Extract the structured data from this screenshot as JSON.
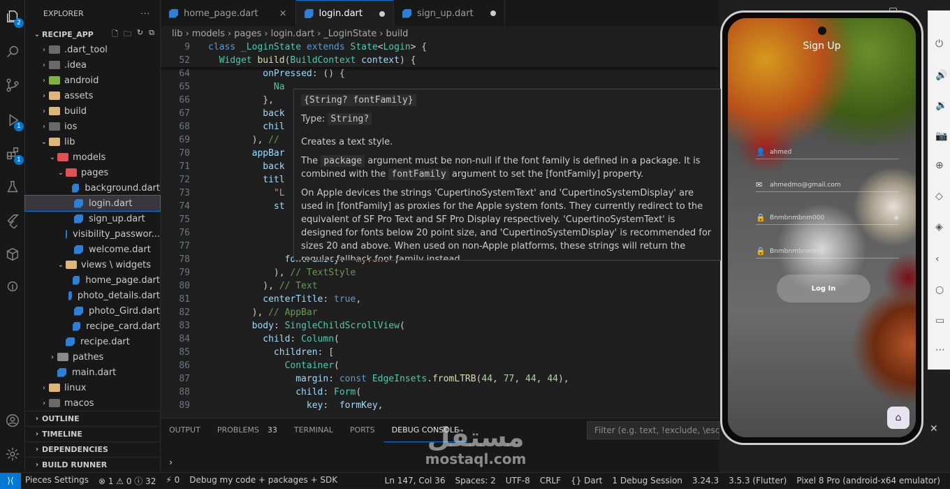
{
  "activity": {
    "explorer_badge": "2",
    "run_badge": "1",
    "extensions_badge": "1"
  },
  "sidebar": {
    "title": "EXPLORER",
    "more": "···",
    "project": "RECIPE_APP",
    "tree": [
      {
        "label": ".dart_tool",
        "type": "folder",
        "depth": 1,
        "chev": "›",
        "color": "#6a6a6a"
      },
      {
        "label": ".idea",
        "type": "folder",
        "depth": 1,
        "chev": "›",
        "color": "#6a6a6a"
      },
      {
        "label": "android",
        "type": "folder",
        "depth": 1,
        "chev": "›",
        "color": "#7cb342"
      },
      {
        "label": "assets",
        "type": "folder",
        "depth": 1,
        "chev": "›",
        "color": "#dcb67a"
      },
      {
        "label": "build",
        "type": "folder",
        "depth": 1,
        "chev": "›",
        "color": "#dcb67a"
      },
      {
        "label": "ios",
        "type": "folder",
        "depth": 1,
        "chev": "›",
        "color": "#6a6a6a"
      },
      {
        "label": "lib",
        "type": "folder",
        "depth": 1,
        "chev": "⌄",
        "color": "#dcb67a"
      },
      {
        "label": "models",
        "type": "folder",
        "depth": 2,
        "chev": "⌄",
        "color": "#e05252"
      },
      {
        "label": "pages",
        "type": "folder",
        "depth": 3,
        "chev": "⌄",
        "color": "#e05252"
      },
      {
        "label": "background.dart",
        "type": "dart",
        "depth": 4
      },
      {
        "label": "login.dart",
        "type": "dart",
        "depth": 4,
        "selected": true
      },
      {
        "label": "sign_up.dart",
        "type": "dart",
        "depth": 4
      },
      {
        "label": "visibility_passwor...",
        "type": "dart",
        "depth": 4
      },
      {
        "label": "welcome.dart",
        "type": "dart",
        "depth": 4
      },
      {
        "label": "views \\ widgets",
        "type": "folder",
        "depth": 3,
        "chev": "⌄",
        "color": "#dcb67a"
      },
      {
        "label": "home_page.dart",
        "type": "dart",
        "depth": 4
      },
      {
        "label": "photo_details.dart",
        "type": "dart",
        "depth": 4
      },
      {
        "label": "photo_Gird.dart",
        "type": "dart",
        "depth": 4
      },
      {
        "label": "recipe_card.dart",
        "type": "dart",
        "depth": 4
      },
      {
        "label": "recipe.dart",
        "type": "dart",
        "depth": 3
      },
      {
        "label": "pathes",
        "type": "folder",
        "depth": 2,
        "chev": "›",
        "color": "#8a8a8a"
      },
      {
        "label": "main.dart",
        "type": "dart",
        "depth": 2
      },
      {
        "label": "linux",
        "type": "folder",
        "depth": 1,
        "chev": "›",
        "color": "#dcb67a"
      },
      {
        "label": "macos",
        "type": "folder",
        "depth": 1,
        "chev": "›",
        "color": "#6a6a6a"
      }
    ],
    "sections": [
      "OUTLINE",
      "TIMELINE",
      "DEPENDENCIES",
      "BUILD RUNNER"
    ]
  },
  "tabs": [
    {
      "label": "home_page.dart",
      "active": false,
      "marker": "×"
    },
    {
      "label": "login.dart",
      "active": true,
      "marker": "dot"
    },
    {
      "label": "sign_up.dart",
      "active": false,
      "marker": "dot"
    }
  ],
  "breadcrumb": [
    "lib",
    "›",
    "models",
    "›",
    "pages",
    "›",
    "login.dart",
    "›",
    "_LoginState",
    "›",
    "build"
  ],
  "editor": {
    "lines": [
      {
        "n": "9",
        "sticky": true,
        "html": "<span class='kw'>class</span> <span class='cls'>_LoginState</span> <span class='kw'>extends</span> <span class='cls'>State</span>&lt;<span class='cls'>Login</span>&gt; {"
      },
      {
        "n": "52",
        "sticky": true,
        "html": "  <span class='cls'>Widget</span> <span class='fn'>build</span>(<span class='cls'>BuildContext</span> <span class='pr'>context</span>) {"
      },
      {
        "n": "64",
        "html": "          <span class='pr'>onPressed</span>: () {"
      },
      {
        "n": "65",
        "html": "            <span class='cls'>Na</span>"
      },
      {
        "n": "66",
        "html": "          },"
      },
      {
        "n": "67",
        "html": "          <span class='pr'>back</span>"
      },
      {
        "n": "68",
        "html": "          <span class='pr'>chil</span>"
      },
      {
        "n": "69",
        "html": "        ), <span class='cm'>//</span>"
      },
      {
        "n": "70",
        "html": "        <span class='pr'>appBar</span>"
      },
      {
        "n": "71",
        "html": "          <span class='pr'>back</span>"
      },
      {
        "n": "72",
        "html": "          <span class='pr'>titl</span>"
      },
      {
        "n": "73",
        "html": "            <span class='str'>\"L</span>"
      },
      {
        "n": "74",
        "html": "            <span class='pr'>st</span>"
      },
      {
        "n": "75",
        "html": ""
      },
      {
        "n": "76",
        "html": ""
      },
      {
        "n": "77",
        "html": ""
      },
      {
        "n": "78",
        "html": "              <span class='pr'>fontFamily</span>: <span class='str'>\"myfont\"</span>,"
      },
      {
        "n": "79",
        "html": "            ), <span class='cm'>// TextStyle</span>"
      },
      {
        "n": "80",
        "html": "          ), <span class='cm'>// Text</span>"
      },
      {
        "n": "81",
        "html": "          <span class='pr'>centerTitle</span>: <span class='kw'>true</span>,"
      },
      {
        "n": "82",
        "html": "        ), <span class='cm'>// AppBar</span>"
      },
      {
        "n": "83",
        "html": "        <span class='pr'>body</span>: <span class='cls'>SingleChildScrollView</span>("
      },
      {
        "n": "84",
        "html": "          <span class='pr'>child</span>: <span class='cls'>Column</span>("
      },
      {
        "n": "85",
        "html": "            <span class='pr'>children</span>: ["
      },
      {
        "n": "86",
        "html": "              <span class='cls'>Container</span>("
      },
      {
        "n": "87",
        "html": "                <span class='pr'>margin</span>: <span class='kw'>const</span> <span class='cls'>EdgeInsets</span>.<span class='fn'>fromLTRB</span>(<span class='num'>44</span>, <span class='num'>77</span>, <span class='num'>44</span>, <span class='num'>44</span>),"
      },
      {
        "n": "88",
        "html": "                <span class='pr'>child</span>: <span class='cls'>Form</span>("
      },
      {
        "n": "89",
        "html": "                  <span class='pr'>key</span>:  <span class='pr'>formKey</span>,"
      }
    ]
  },
  "hover": {
    "sig": "{String? fontFamily}",
    "type_label": "Type:",
    "type_value": "String?",
    "p1": "Creates a text style.",
    "p2_a": "The",
    "p2_code1": "package",
    "p2_b": "argument must be non-null if the font family is defined in a package. It is combined with the",
    "p2_code2": "fontFamily",
    "p2_c": "argument to set the [fontFamily] property.",
    "p3": "On Apple devices the strings 'CupertinoSystemText' and 'CupertinoSystemDisplay' are used in [fontFamily] as proxies for the Apple system fonts. They currently redirect to the equivalent of SF Pro Text and SF Pro Display respectively. 'CupertinoSystemText' is designed for fonts below 20 point size, and 'CupertinoSystemDisplay' is recommended for sizes 20 and above. When used on non-Apple platforms, these strings will return the regular fallback font family instead."
  },
  "panel": {
    "tabs": [
      "OUTPUT",
      "PROBLEMS",
      "TERMINAL",
      "PORTS",
      "DEBUG CONSOLE"
    ],
    "problems_count": "33",
    "active": "DEBUG CONSOLE",
    "filter_placeholder": "Filter (e.g. text, !exclude, \\escape)",
    "prompt": "›"
  },
  "status": {
    "items_left": [
      "Pieces Settings",
      "⊗ 1 ⚠ 0 ⓘ 32",
      "⚡ 0",
      "Debug my code + packages + SDK"
    ],
    "items_right": [
      "Ln 147, Col 36",
      "Spaces: 2",
      "UTF-8",
      "CRLF",
      "{} Dart",
      "1 Debug Session",
      "3.24.3",
      "3.5.3 (Flutter)",
      "Pixel 8 Pro (android-x64 emulator)"
    ]
  },
  "phone": {
    "title": "Sign Up",
    "fields": [
      {
        "icon": "person-icon",
        "glyph": "👤",
        "text": "ahmed"
      },
      {
        "icon": "email-icon",
        "glyph": "✉",
        "text": "ahmedmo@gmail.com"
      },
      {
        "icon": "lock-icon",
        "glyph": "🔒",
        "text": "Bnmbnmbnm000"
      },
      {
        "icon": "lock-icon",
        "glyph": "🔒",
        "text": "Bnmbnmbnm000"
      }
    ],
    "login": "Log In"
  },
  "watermark": {
    "ar": "مستقل",
    "en": "mostaql.com"
  }
}
